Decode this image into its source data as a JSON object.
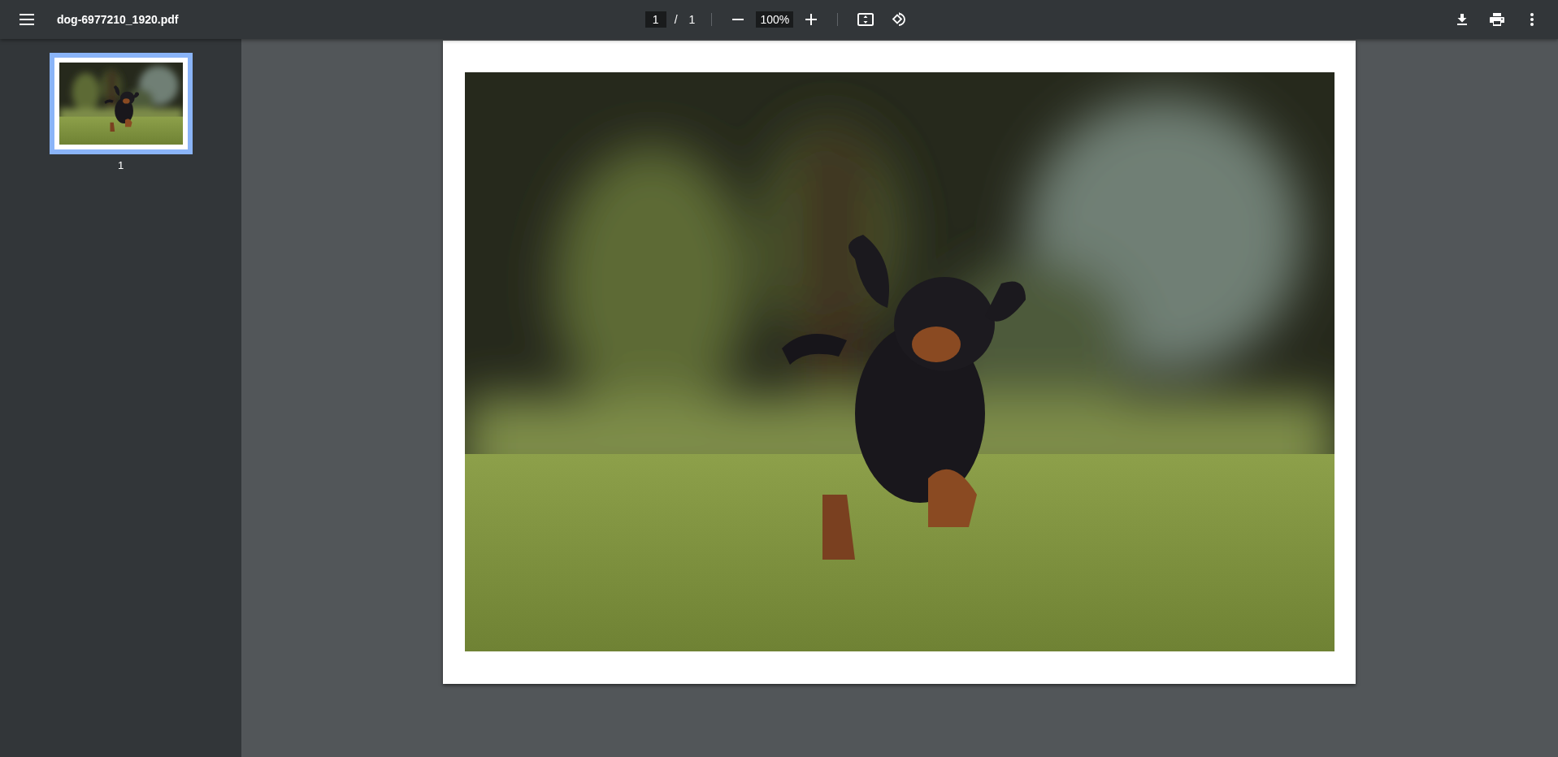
{
  "toolbar": {
    "file_name": "dog-6977210_1920.pdf",
    "page_field": "1",
    "page_separator": "/",
    "page_count": "1",
    "zoom_field": "100%"
  },
  "sidebar": {
    "thumbnails": [
      {
        "label": "1",
        "selected": true
      }
    ]
  }
}
